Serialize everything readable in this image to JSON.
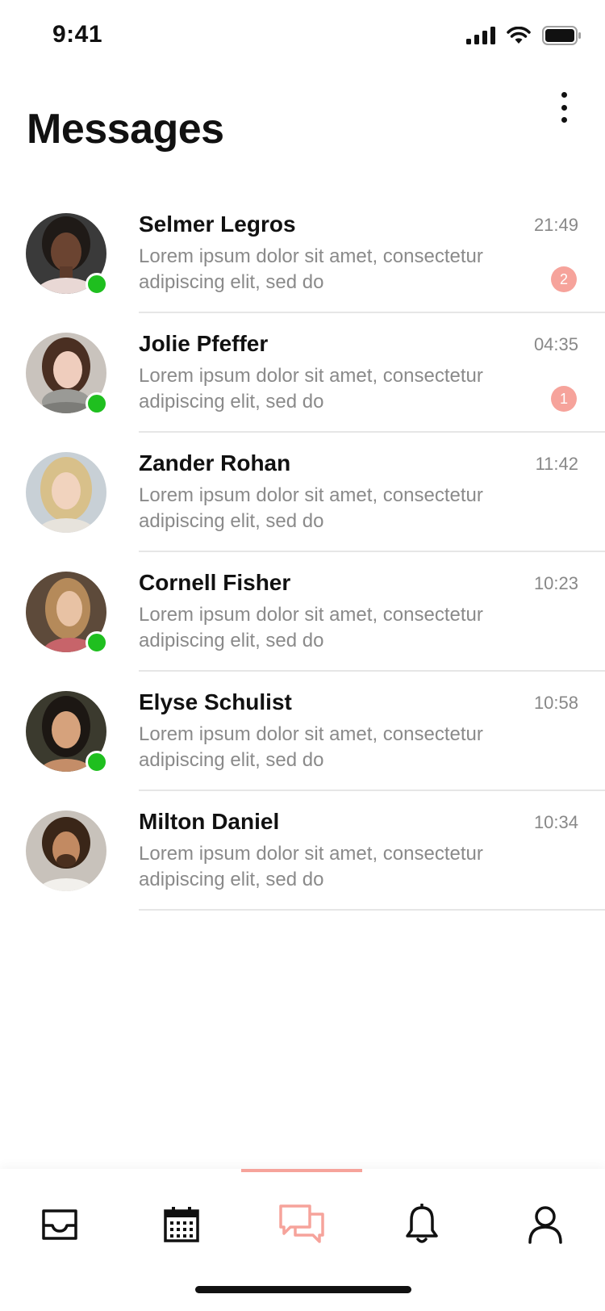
{
  "status_bar": {
    "time": "9:41"
  },
  "header": {
    "title": "Messages"
  },
  "conversations": [
    {
      "name": "Selmer Legros",
      "time": "21:49",
      "preview": "Lorem ipsum dolor sit amet, consectetur adipiscing elit, sed do",
      "unread": "2",
      "online": true
    },
    {
      "name": "Jolie Pfeffer",
      "time": "04:35",
      "preview": "Lorem ipsum dolor sit amet, consectetur adipiscing elit, sed do",
      "unread": "1",
      "online": true
    },
    {
      "name": "Zander Rohan",
      "time": "11:42",
      "preview": "Lorem ipsum dolor sit amet, consectetur adipiscing elit, sed do",
      "unread": "",
      "online": false
    },
    {
      "name": "Cornell Fisher",
      "time": "10:23",
      "preview": "Lorem ipsum dolor sit amet, consectetur adipiscing elit, sed do",
      "unread": "",
      "online": true
    },
    {
      "name": "Elyse Schulist",
      "time": "10:58",
      "preview": "Lorem ipsum dolor sit amet, consectetur adipiscing elit, sed do",
      "unread": "",
      "online": true
    },
    {
      "name": "Milton Daniel",
      "time": "10:34",
      "preview": "Lorem ipsum dolor sit amet, consectetur adipiscing elit, sed do",
      "unread": "",
      "online": false
    }
  ],
  "tab_bar": {
    "tabs": [
      {
        "icon": "inbox-icon",
        "active": false
      },
      {
        "icon": "calendar-icon",
        "active": false
      },
      {
        "icon": "chat-bubbles-icon",
        "active": true
      },
      {
        "icon": "bell-icon",
        "active": false
      },
      {
        "icon": "user-icon",
        "active": false
      }
    ]
  },
  "colors": {
    "accent": "#f6a39b",
    "online": "#1fbf1f",
    "text_primary": "#111111",
    "text_secondary": "#8a8a8a",
    "divider": "#e6e6e6"
  }
}
